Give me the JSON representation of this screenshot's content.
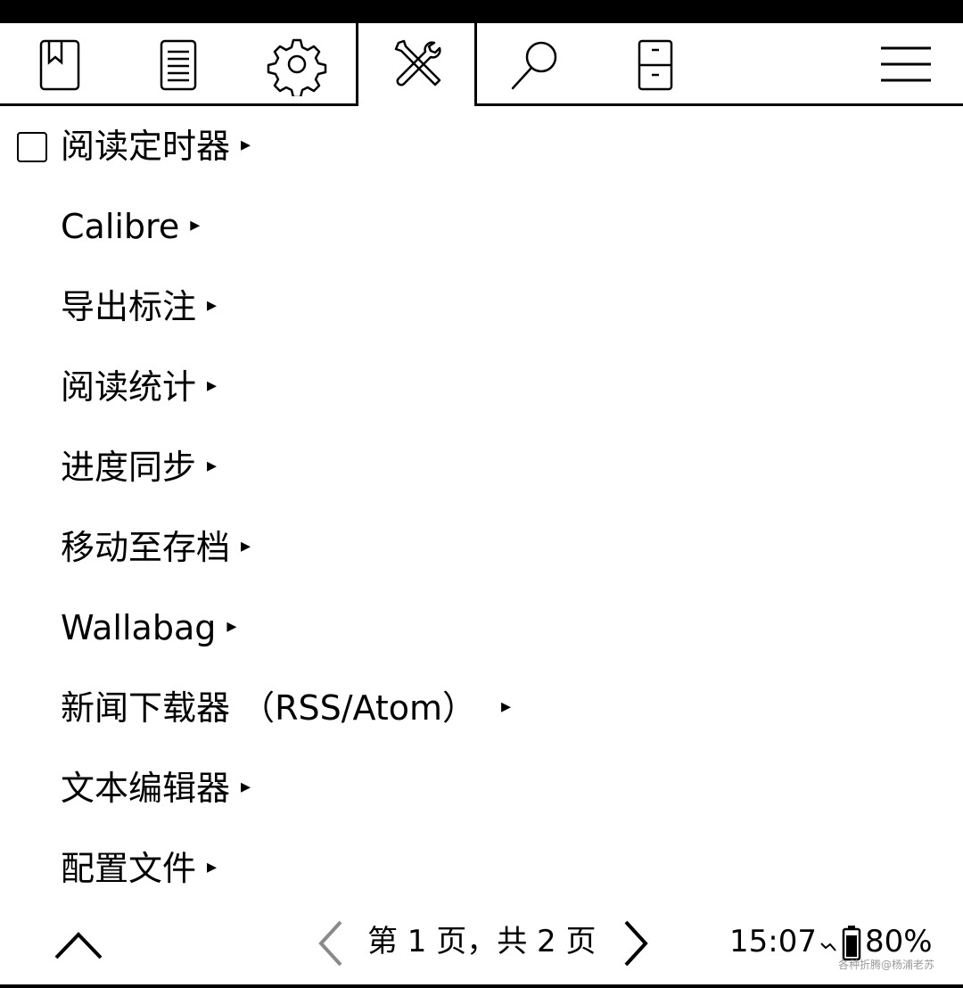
{
  "tabs": [
    {
      "icon": "bookmark-book-icon"
    },
    {
      "icon": "document-list-icon"
    },
    {
      "icon": "gear-icon"
    },
    {
      "icon": "tools-icon",
      "active": true
    },
    {
      "icon": "search-icon"
    },
    {
      "icon": "cabinet-icon"
    }
  ],
  "menu_icon": "hamburger-menu-icon",
  "menu": {
    "items": [
      {
        "label": "阅读定时器",
        "checkbox": true,
        "checked": false
      },
      {
        "label": "Calibre"
      },
      {
        "label": "导出标注"
      },
      {
        "label": "阅读统计"
      },
      {
        "label": "进度同步"
      },
      {
        "label": "移动至存档"
      },
      {
        "label": "Wallabag"
      },
      {
        "label": "新闻下载器 （RSS/Atom）"
      },
      {
        "label": "文本编辑器"
      },
      {
        "label": "配置文件"
      }
    ],
    "arrow": "▸"
  },
  "footer": {
    "page_info": "第 1 页，共 2 页",
    "clock": "15:07",
    "battery": "80%",
    "watermark": "各种折腾@杨浦老苏"
  }
}
